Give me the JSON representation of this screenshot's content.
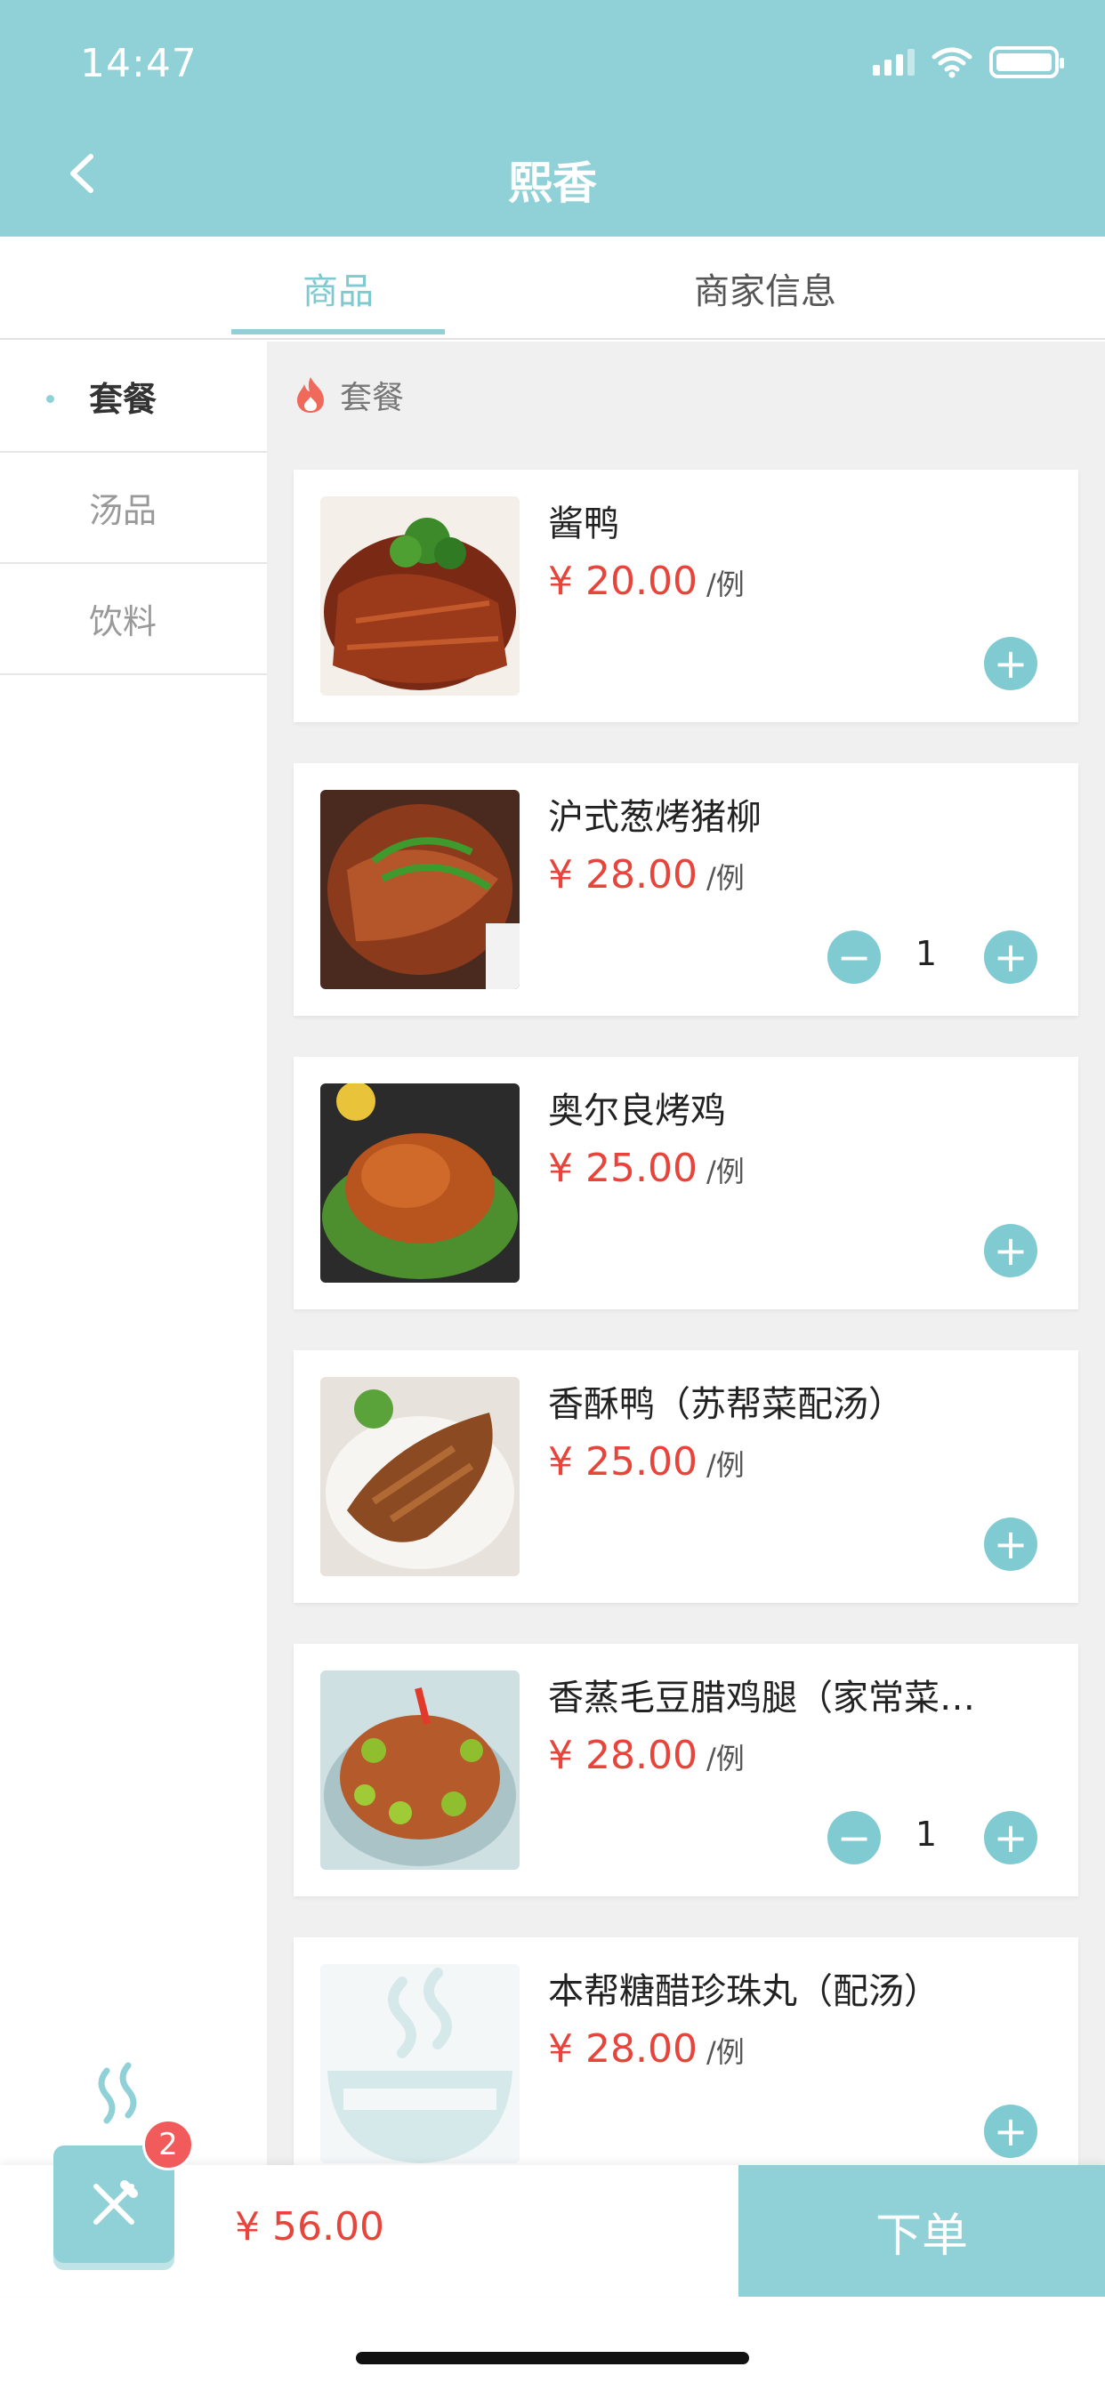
{
  "status_bar": {
    "time": "14:47"
  },
  "nav": {
    "title": "熙香"
  },
  "tabs": [
    {
      "label": "商品"
    },
    {
      "label": "商家信息"
    }
  ],
  "sidebar": {
    "items": [
      {
        "label": "套餐",
        "active": true
      },
      {
        "label": "汤品",
        "active": false
      },
      {
        "label": "饮料",
        "active": false
      }
    ]
  },
  "section": {
    "title": "套餐"
  },
  "currency": "¥",
  "products": [
    {
      "name": "酱鸭",
      "price": "¥ 20.00",
      "unit": "/例",
      "qty": ""
    },
    {
      "name": "沪式葱烤猪柳",
      "price": "¥ 28.00",
      "unit": "/例",
      "qty": "1"
    },
    {
      "name": "奥尔良烤鸡",
      "price": "¥ 25.00",
      "unit": "/例",
      "qty": ""
    },
    {
      "name": "香酥鸭（苏帮菜配汤）",
      "price": "¥ 25.00",
      "unit": "/例",
      "qty": ""
    },
    {
      "name": "香蒸毛豆腊鸡腿（家常菜…",
      "price": "¥ 28.00",
      "unit": "/例",
      "qty": "1"
    },
    {
      "name": "本帮糖醋珍珠丸（配汤）",
      "price": "¥ 28.00",
      "unit": "/例",
      "qty": ""
    }
  ],
  "cart": {
    "badge": "2",
    "total": "¥ 56.00",
    "order_label": "下单"
  },
  "colors": {
    "accent": "#8fd1d6",
    "price": "#e7453b",
    "badge": "#f25b5b"
  }
}
